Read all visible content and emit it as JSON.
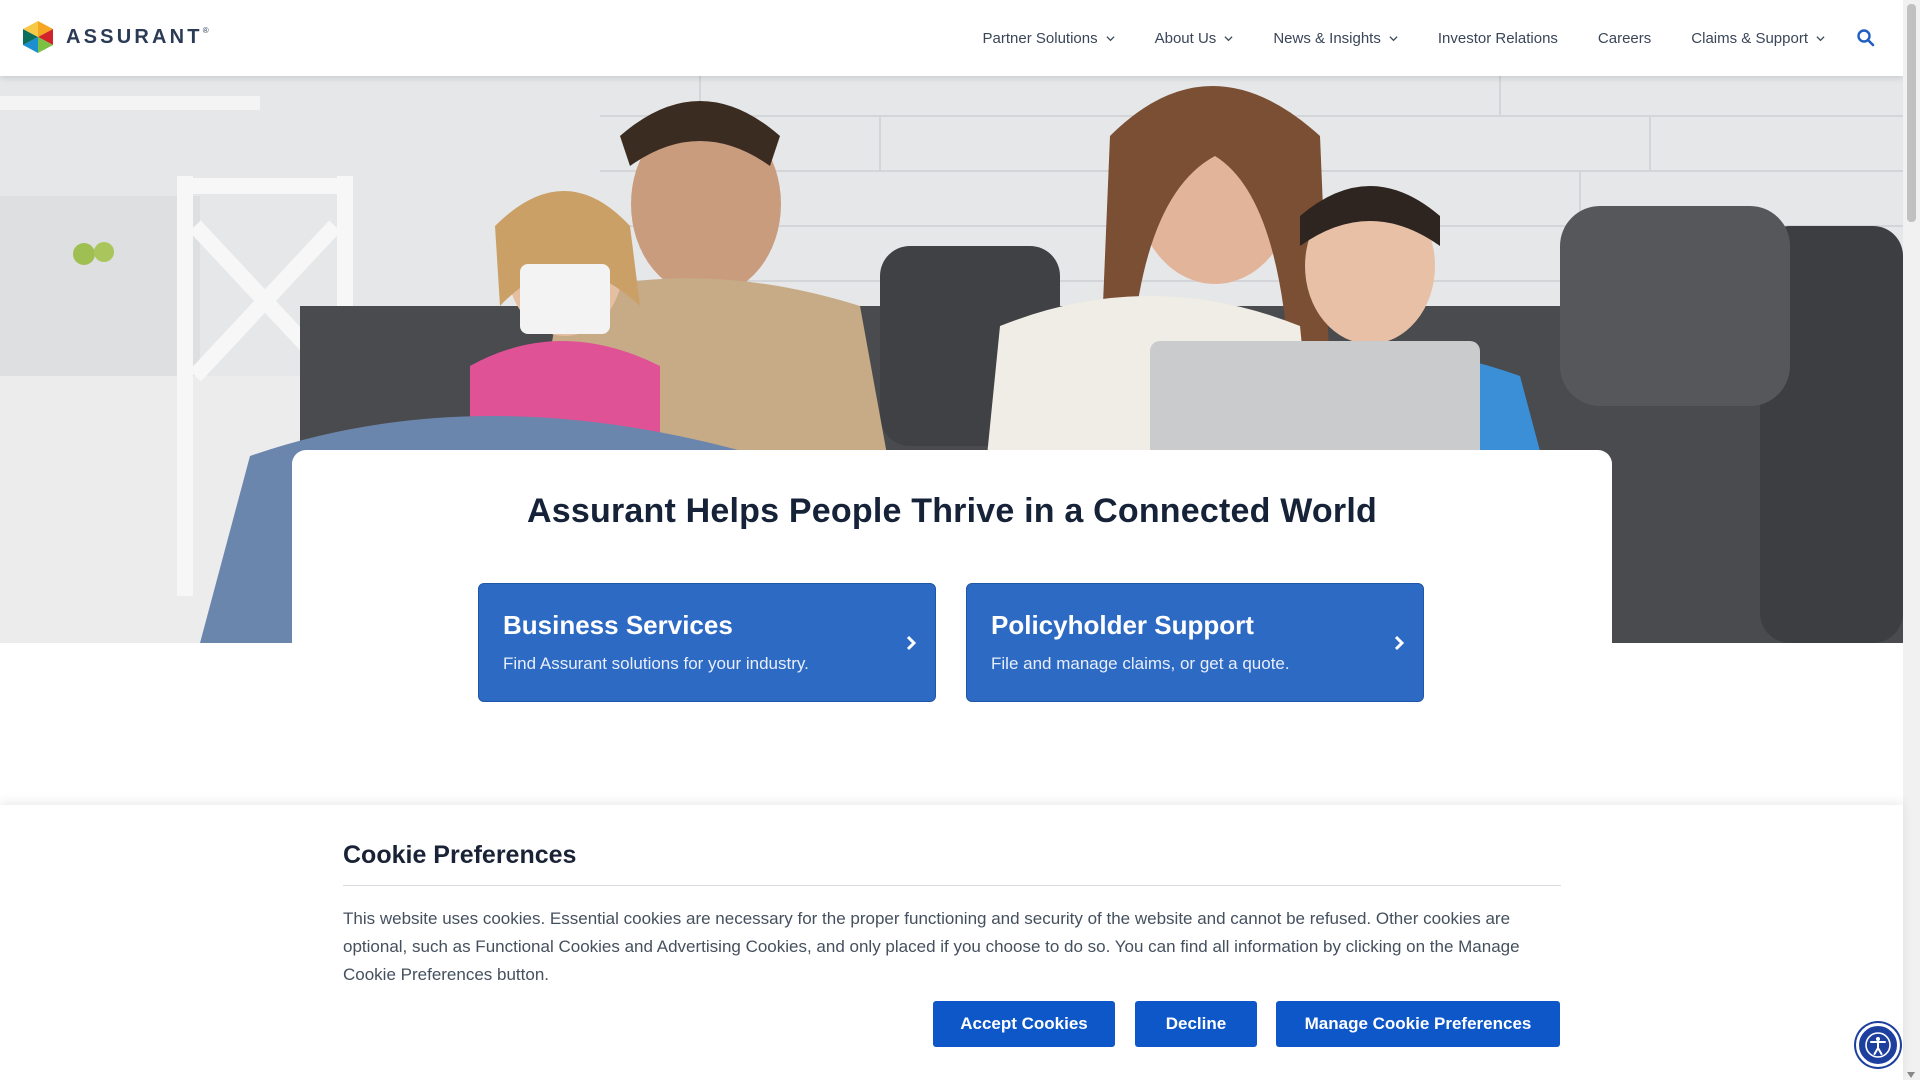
{
  "brand": {
    "name": "ASSURANT",
    "mark": "®"
  },
  "nav": {
    "items": [
      {
        "label": "Partner Solutions",
        "dropdown": true
      },
      {
        "label": "About Us",
        "dropdown": true
      },
      {
        "label": "News & Insights",
        "dropdown": true
      },
      {
        "label": "Investor Relations",
        "dropdown": false
      },
      {
        "label": "Careers",
        "dropdown": false
      },
      {
        "label": "Claims & Support",
        "dropdown": true
      }
    ],
    "search_icon": "search-icon"
  },
  "hero": {
    "title": "Assurant Helps People Thrive in a Connected World",
    "cards": [
      {
        "title": "Business Services",
        "subtitle": "Find Assurant solutions for your industry."
      },
      {
        "title": "Policyholder Support",
        "subtitle": "File and manage claims, or get a quote."
      }
    ]
  },
  "cookie_banner": {
    "title": "Cookie Preferences",
    "text": "This website uses cookies. Essential cookies are necessary for the proper functioning and security of the website and cannot be refused. Other cookies are optional, such as Functional Cookies and Advertising Cookies, and only placed if you choose to do so. You can find all information by clicking on the Manage Cookie Preferences button.",
    "accept_label": "Accept Cookies",
    "decline_label": "Decline",
    "manage_label": "Manage Cookie Preferences"
  },
  "colors": {
    "primary": "#2d6ac3",
    "cookie_button": "#0e57c9",
    "heading": "#152238"
  },
  "accessibility_icon": "accessibility-icon"
}
